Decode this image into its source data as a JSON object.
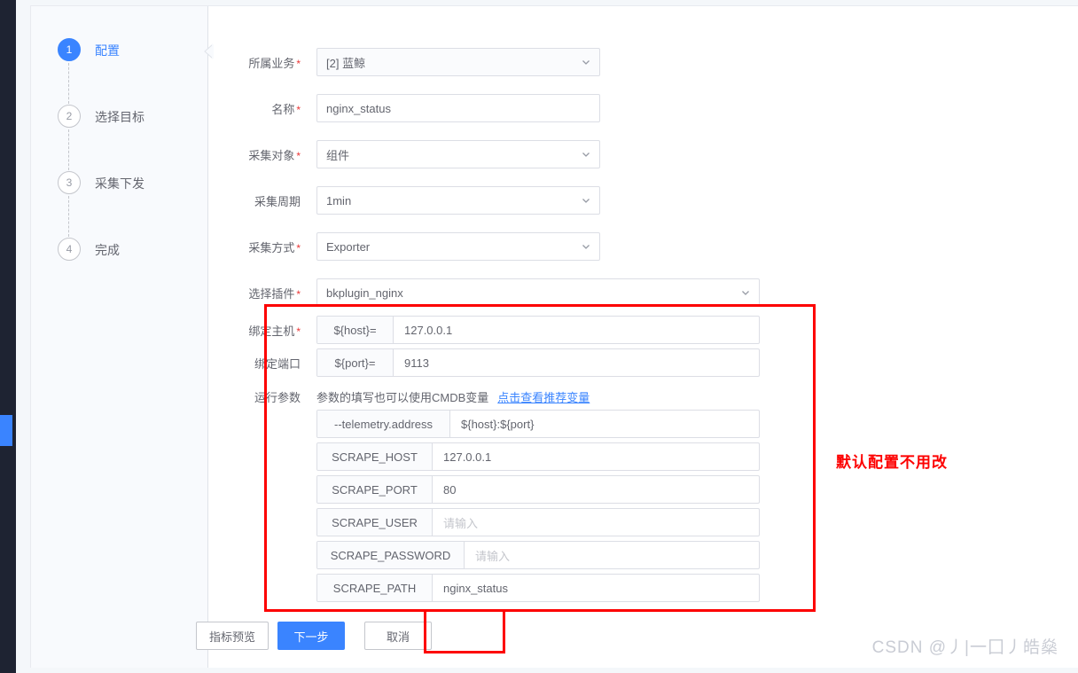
{
  "steps": [
    {
      "number": "1",
      "label": "配置",
      "active": true
    },
    {
      "number": "2",
      "label": "选择目标",
      "active": false
    },
    {
      "number": "3",
      "label": "采集下发",
      "active": false
    },
    {
      "number": "4",
      "label": "完成",
      "active": false
    }
  ],
  "form": {
    "business": {
      "label": "所属业务",
      "required": true,
      "value": "[2] 蓝鲸",
      "type": "select"
    },
    "name": {
      "label": "名称",
      "required": true,
      "value": "nginx_status",
      "type": "input"
    },
    "target": {
      "label": "采集对象",
      "required": true,
      "value": "组件",
      "type": "select"
    },
    "period": {
      "label": "采集周期",
      "required": false,
      "value": "1min",
      "type": "select"
    },
    "method": {
      "label": "采集方式",
      "required": true,
      "value": "Exporter",
      "type": "select"
    },
    "plugin": {
      "label": "选择插件",
      "required": true,
      "value": "bkplugin_nginx",
      "type": "select"
    }
  },
  "bind": {
    "host": {
      "label": "绑定主机",
      "required": true,
      "key": "${host}=",
      "value": "127.0.0.1"
    },
    "port": {
      "label": "绑定端口",
      "required": false,
      "key": "${port}=",
      "value": "9113"
    }
  },
  "runtime": {
    "label": "运行参数",
    "hint": "参数的填写也可以使用CMDB变量",
    "link": "点击查看推荐变量",
    "params": [
      {
        "key": "--telemetry.address",
        "value": "${host}:${port}",
        "placeholder": false
      },
      {
        "key": "SCRAPE_HOST",
        "value": "127.0.0.1",
        "placeholder": false
      },
      {
        "key": "SCRAPE_PORT",
        "value": "80",
        "placeholder": false
      },
      {
        "key": "SCRAPE_USER",
        "value": "请输入",
        "placeholder": true
      },
      {
        "key": "SCRAPE_PASSWORD",
        "value": "请输入",
        "placeholder": true
      },
      {
        "key": "SCRAPE_PATH",
        "value": "nginx_status",
        "placeholder": false
      }
    ]
  },
  "buttons": {
    "preview": "指标预览",
    "next": "下一步",
    "cancel": "取消"
  },
  "annotation": {
    "note": "默认配置不用改",
    "color": "#fd0000"
  },
  "watermark": "CSDN @丿|一囗丿皓燊",
  "colors": {
    "primary": "#3a84ff",
    "rail": "#1e2332",
    "border": "#dcdee5",
    "text": "#63656e",
    "placeholder": "#c4c6cc",
    "required": "#ea3636"
  }
}
